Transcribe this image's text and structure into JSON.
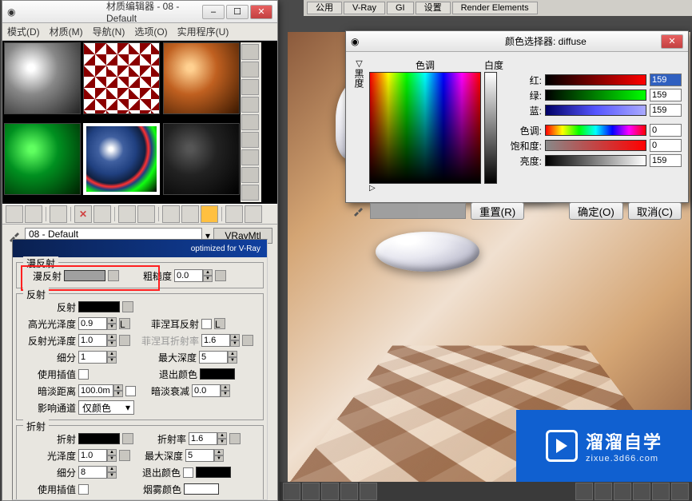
{
  "bg_tabs": [
    "公用",
    "V-Ray",
    "GI",
    "设置",
    "Render Elements"
  ],
  "mat_editor": {
    "title": "材质编辑器 - 08 - Default",
    "menu": [
      "模式(D)",
      "材质(M)",
      "导航(N)",
      "选项(O)",
      "实用程序(U)"
    ],
    "material_name": "08 - Default",
    "material_type": "VRayMtl",
    "banner": "optimized for V-Ray"
  },
  "diffuse_group": {
    "title": "漫反射",
    "diffuse_label": "漫反射",
    "roughness_label": "粗糙度",
    "roughness_value": "0.0"
  },
  "reflect_group": {
    "title": "反射",
    "reflect_label": "反射",
    "hilight_gloss_label": "高光光泽度",
    "hilight_gloss_value": "0.9",
    "refl_gloss_label": "反射光泽度",
    "refl_gloss_value": "1.0",
    "subdiv_label": "细分",
    "subdiv_value": "1",
    "use_interp_label": "使用插值",
    "dim_dist_label": "暗淡距离",
    "dim_dist_value": "100.0m",
    "affect_label": "影响通道",
    "affect_value": "仅颜色",
    "fresnel_label": "菲涅耳反射",
    "fresnel_ior_label": "菲涅耳折射率",
    "fresnel_ior_value": "1.6",
    "max_depth_label": "最大深度",
    "max_depth_value": "5",
    "exit_color_label": "退出颜色",
    "dim_falloff_label": "暗淡衰减",
    "dim_falloff_value": "0.0"
  },
  "refract_group": {
    "title": "折射",
    "refract_label": "折射",
    "gloss_label": "光泽度",
    "gloss_value": "1.0",
    "subdiv_label": "细分",
    "subdiv_value": "8",
    "use_interp_label": "使用插值",
    "affect_shadows_label": "退出颜色",
    "ior_label": "折射率",
    "ior_value": "1.6",
    "max_depth_label": "最大深度",
    "max_depth_value": "5",
    "exit_color_label": "退出颜色",
    "fog_color_label": "烟雾颜色"
  },
  "color_picker": {
    "title": "颜色选择器: diffuse",
    "hue_header": "色调",
    "white_header": "白度",
    "black_label": "黑度",
    "red_label": "红:",
    "red_value": "159",
    "green_label": "绿:",
    "green_value": "159",
    "blue_label": "蓝:",
    "blue_value": "159",
    "hue_label": "色调:",
    "hue_value": "0",
    "sat_label": "饱和度:",
    "sat_value": "0",
    "val_label": "亮度:",
    "val_value": "159",
    "reset_btn": "重置(R)",
    "ok_btn": "确定(O)",
    "cancel_btn": "取消(C)"
  },
  "logo": {
    "name": "溜溜自学",
    "url": "zixue.3d66.com"
  }
}
